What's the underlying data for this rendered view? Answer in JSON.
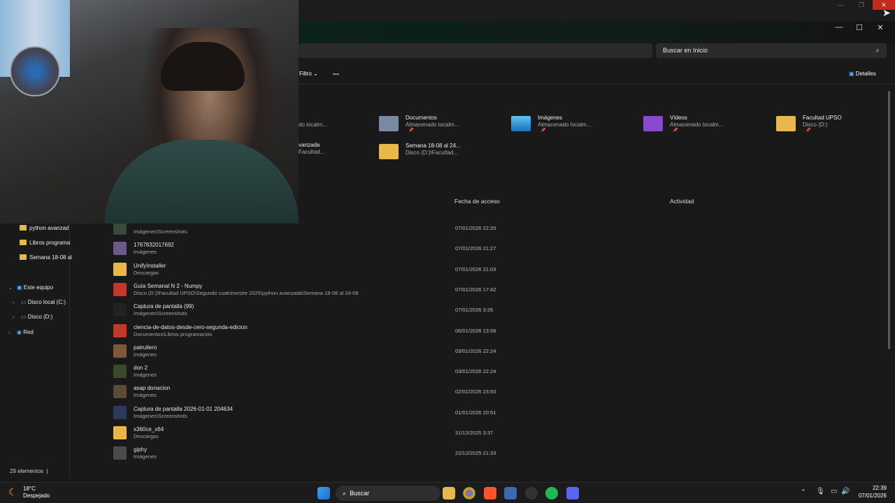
{
  "search": {
    "placeholder": "Buscar en Inicio"
  },
  "commandbar": {
    "filter_label": "Filtro",
    "more_label": "...",
    "details_label": "Detalles"
  },
  "quick_access": [
    {
      "name": "Documentos",
      "sub": "Almacenado localm...",
      "color": "#7a8aa0"
    },
    {
      "name": "Imágenes",
      "sub": "Almacenado localm...",
      "color": "#3aa0e0"
    },
    {
      "name": "Vídeos",
      "sub": "Almacenado localm...",
      "color": "#8a4ad0"
    },
    {
      "name": "Facultad UPSO",
      "sub": "Disco (D:)",
      "color": "#e8b84a"
    },
    {
      "name": "Semana 18-08 al 24...",
      "sub": "Disco (D:)\\Facultad...",
      "color": "#e8b84a"
    }
  ],
  "partial_left": {
    "line1": "do localm...",
    "line2": "vanzada",
    "line3": "Facultad..."
  },
  "columns": {
    "accessed": "Fecha de acceso",
    "activity": "Actividad"
  },
  "sidebar": {
    "items": [
      {
        "label": "python avanzad"
      },
      {
        "label": "Libros programa"
      },
      {
        "label": "Semana 18-08 al"
      },
      {
        "label": "Este equipo"
      },
      {
        "label": "Disco local (C:)"
      },
      {
        "label": "Disco (D:)"
      },
      {
        "label": "Red"
      }
    ]
  },
  "files": [
    {
      "name": "",
      "path": "Imágenes\\Screenshots",
      "date": "07/01/2026 22:20",
      "thumb": "#3a4a3a"
    },
    {
      "name": "1767832017692",
      "path": "Imágenes",
      "date": "07/01/2026 21:27",
      "thumb": "#6a5a8a"
    },
    {
      "name": "UnifyInstaller",
      "path": "Descargas",
      "date": "07/01/2026 21:03",
      "thumb": "#e8b84a"
    },
    {
      "name": "Guía Semanal N 2 - Numpy",
      "path": "Disco (D:)\\Facultad UPSO\\Segundo cuatrimestre 2025\\python avanzada\\Semana 18-08 al 24-08",
      "date": "07/01/2026 17:42",
      "thumb": "#c0392b"
    },
    {
      "name": "Captura de pantalla (99)",
      "path": "Imágenes\\Screenshots",
      "date": "07/01/2026 3:26",
      "thumb": "#222222"
    },
    {
      "name": "ciencia-de-datos-desde-cero-segunda-edicion",
      "path": "Documentos\\Libros programación",
      "date": "06/01/2026 13:56",
      "thumb": "#c0392b"
    },
    {
      "name": "patrullero",
      "path": "Imágenes",
      "date": "03/01/2026 22:24",
      "thumb": "#7a5a3a"
    },
    {
      "name": "don 2",
      "path": "Imágenes",
      "date": "03/01/2026 22:24",
      "thumb": "#3a4a2a"
    },
    {
      "name": "asap donacion",
      "path": "Imágenes",
      "date": "02/01/2026 23:50",
      "thumb": "#5a4a3a"
    },
    {
      "name": "Captura de pantalla 2026-01-01 204634",
      "path": "Imágenes\\Screenshots",
      "date": "01/01/2026 20:51",
      "thumb": "#2a3a5a"
    },
    {
      "name": "x360ce_x64",
      "path": "Descargas",
      "date": "31/12/2025 3:37",
      "thumb": "#e8b84a"
    },
    {
      "name": "giphy",
      "path": "Imágenes",
      "date": "22/12/2025 21:33",
      "thumb": "#4a4a4a"
    }
  ],
  "status": {
    "count": "29 elementos"
  },
  "taskbar": {
    "weather_temp": "18°C",
    "weather_desc": "Despejado",
    "search_label": "Buscar",
    "time": "22:39",
    "date": "07/01/2026"
  }
}
